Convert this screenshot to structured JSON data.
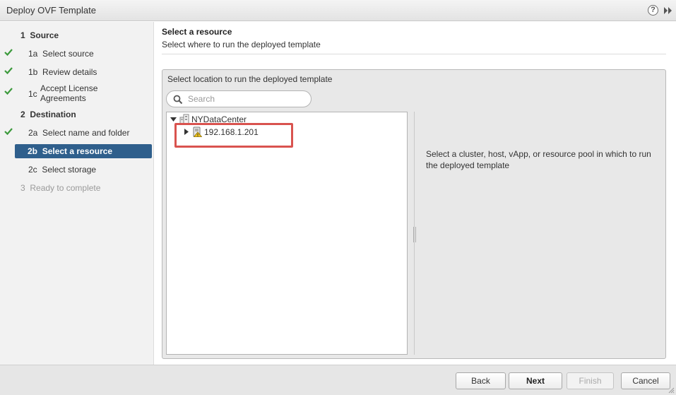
{
  "window": {
    "title": "Deploy OVF Template",
    "help_glyph": "?"
  },
  "sidebar": {
    "steps": [
      {
        "number": "1",
        "label": "Source",
        "state": "header"
      },
      {
        "number": "1a",
        "label": "Select source",
        "state": "completed"
      },
      {
        "number": "1b",
        "label": "Review details",
        "state": "completed"
      },
      {
        "number": "1c",
        "label": "Accept License Agreements",
        "line1": "Accept License",
        "line2": "Agreements",
        "state": "completed"
      },
      {
        "number": "2",
        "label": "Destination",
        "state": "header"
      },
      {
        "number": "2a",
        "label": "Select name and folder",
        "state": "completed"
      },
      {
        "number": "2b",
        "label": "Select a resource",
        "state": "active"
      },
      {
        "number": "2c",
        "label": "Select storage",
        "state": "pending"
      },
      {
        "number": "3",
        "label": "Ready to complete",
        "state": "disabled"
      }
    ],
    "check_color": "#3c9a3c",
    "active_color": "#2f5f8c"
  },
  "main": {
    "title": "Select a resource",
    "subtitle": "Select where to run the deployed template",
    "panel_label": "Select location to run the deployed template",
    "search": {
      "placeholder": "Search",
      "value": ""
    },
    "tree": {
      "root": {
        "label": "NYDataCenter",
        "icon": "datacenter-icon",
        "expanded": true
      },
      "children": [
        {
          "label": "192.168.1.201",
          "icon": "host-warning-icon",
          "expanded": false,
          "highlighted": true
        }
      ]
    },
    "info": "Select a cluster, host, vApp, or resource pool in which to run the deployed template"
  },
  "footer": {
    "back_label": "Back",
    "next_label": "Next",
    "finish_label": "Finish",
    "cancel_label": "Cancel"
  },
  "colors": {
    "highlight": "#d9534f",
    "warning": "#f0c419"
  }
}
